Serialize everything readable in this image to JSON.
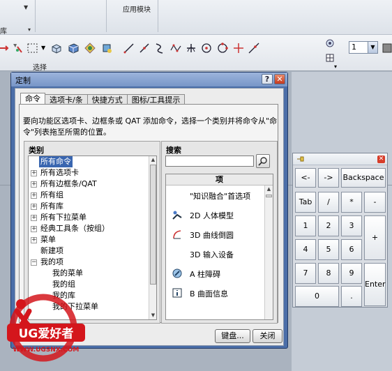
{
  "ribbon": {
    "group_label_left": "库",
    "group_label_app": "应用模块",
    "selection_label": "选择",
    "dropdown_value": "1"
  },
  "dialog": {
    "title": "定制",
    "tabs": [
      {
        "label": "命令",
        "active": true
      },
      {
        "label": "选项卡/条",
        "active": false
      },
      {
        "label": "快捷方式",
        "active": false
      },
      {
        "label": "图标/工具提示",
        "active": false
      }
    ],
    "description": "要向功能区选项卡、边框条或 QAT 添加命令，选择一个类别并将命令从\"命令\"列表拖至所需的位置。",
    "category_header": "类别",
    "categories": [
      {
        "label": "所有命令",
        "level": 0,
        "expander": "",
        "selected": true
      },
      {
        "label": "所有选项卡",
        "level": 0,
        "expander": "+",
        "selected": false
      },
      {
        "label": "所有边框条/QAT",
        "level": 0,
        "expander": "+",
        "selected": false
      },
      {
        "label": "所有组",
        "level": 0,
        "expander": "+",
        "selected": false
      },
      {
        "label": "所有库",
        "level": 0,
        "expander": "+",
        "selected": false
      },
      {
        "label": "所有下拉菜单",
        "level": 0,
        "expander": "+",
        "selected": false
      },
      {
        "label": "经典工具条（按组）",
        "level": 0,
        "expander": "+",
        "selected": false
      },
      {
        "label": "菜单",
        "level": 0,
        "expander": "+",
        "selected": false
      },
      {
        "label": "新建项",
        "level": 0,
        "expander": "",
        "selected": false
      },
      {
        "label": "我的项",
        "level": 0,
        "expander": "-",
        "selected": false
      },
      {
        "label": "我的菜单",
        "level": 1,
        "expander": "",
        "selected": false
      },
      {
        "label": "我的组",
        "level": 1,
        "expander": "",
        "selected": false
      },
      {
        "label": "我的库",
        "level": 1,
        "expander": "",
        "selected": false
      },
      {
        "label": "我的下拉菜单",
        "level": 1,
        "expander": "",
        "selected": false
      }
    ],
    "search_header": "搜索",
    "search_value": "",
    "items_header": "项",
    "items": [
      {
        "label": "\"知识融合\"首选项",
        "icon": "none"
      },
      {
        "label": "2D 人体模型",
        "icon": "human-model-icon"
      },
      {
        "label": "3D 曲线倒圆",
        "icon": "curve-fillet-icon"
      },
      {
        "label": "3D 输入设备",
        "icon": "none"
      },
      {
        "label": "A 柱障碍",
        "icon": "pillar-obstruction-icon"
      },
      {
        "label": "B 曲面信息",
        "icon": "surface-info-icon"
      }
    ],
    "keyboard_button": "键盘...",
    "close_button": "关闭"
  },
  "keypad": {
    "keys": [
      {
        "label": "<-",
        "id": "back"
      },
      {
        "label": "->",
        "id": "fwd"
      },
      {
        "label": "Backspace",
        "id": "bksp"
      },
      {
        "label": "Tab",
        "id": "tab"
      },
      {
        "label": "/",
        "id": "div"
      },
      {
        "label": "*",
        "id": "mul"
      },
      {
        "label": "-",
        "id": "sub"
      },
      {
        "label": "1",
        "id": "k1"
      },
      {
        "label": "2",
        "id": "k2"
      },
      {
        "label": "3",
        "id": "k3"
      },
      {
        "label": "+",
        "id": "add"
      },
      {
        "label": "4",
        "id": "k4"
      },
      {
        "label": "5",
        "id": "k5"
      },
      {
        "label": "6",
        "id": "k6"
      },
      {
        "label": "7",
        "id": "k7"
      },
      {
        "label": "8",
        "id": "k8"
      },
      {
        "label": "9",
        "id": "k9"
      },
      {
        "label": "Enter",
        "id": "enter"
      },
      {
        "label": "0",
        "id": "k0"
      },
      {
        "label": ".",
        "id": "dot"
      }
    ]
  },
  "watermark": {
    "brand": "UG爱好者",
    "url": "WWW.UGSNX.COM"
  },
  "colors": {
    "dialog_frame": "#4b6ea8",
    "selection": "#3966b0",
    "watermark_red": "#d4161c"
  }
}
